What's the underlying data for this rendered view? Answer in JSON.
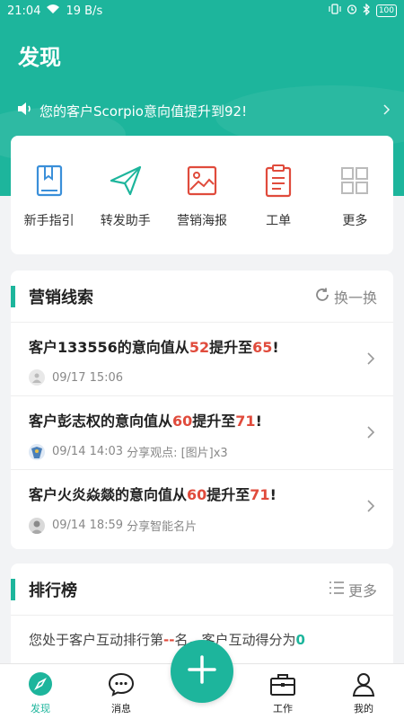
{
  "status_bar": {
    "time": "21:04",
    "net_speed": "19 B/s",
    "battery": "100"
  },
  "header": {
    "title": "发现"
  },
  "notice": {
    "text": "您的客户Scorpio意向值提升到92!"
  },
  "shortcuts": [
    {
      "label": "新手指引",
      "icon": "guide-book-icon",
      "color": "#3a8fd9"
    },
    {
      "label": "转发助手",
      "icon": "paper-plane-icon",
      "color": "#1db59c"
    },
    {
      "label": "营销海报",
      "icon": "poster-image-icon",
      "color": "#e04b3c"
    },
    {
      "label": "工单",
      "icon": "clipboard-icon",
      "color": "#e04b3c"
    },
    {
      "label": "更多",
      "icon": "grid-icon",
      "color": "#bbbbbb"
    }
  ],
  "leads": {
    "title": "营销线索",
    "refresh_label": "换一换",
    "items": [
      {
        "prefix": "客户133556的意向值从",
        "from": "52",
        "mid": "提升至",
        "to": "65",
        "suffix": "!",
        "time": "09/17 15:06",
        "share": ""
      },
      {
        "prefix": "客户彭志权的意向值从",
        "from": "60",
        "mid": "提升至",
        "to": "71",
        "suffix": "!",
        "time": "09/14 14:03",
        "share": "分享观点:  [图片]x3"
      },
      {
        "prefix": "客户火炎焱燚的意向值从",
        "from": "60",
        "mid": "提升至",
        "to": "71",
        "suffix": "!",
        "time": "09/14 18:59",
        "share": "分享智能名片"
      }
    ]
  },
  "ranking": {
    "title": "排行榜",
    "more_label": "更多",
    "line_prefix": "您处于客户互动排行第",
    "rank_value": "--",
    "line_mid": "名，客户互动得分为",
    "score_value": "0"
  },
  "tabbar": [
    {
      "label": "发现",
      "active": true
    },
    {
      "label": "消息",
      "active": false
    },
    {
      "label": "工作",
      "active": false
    },
    {
      "label": "我的",
      "active": false
    }
  ],
  "colors": {
    "primary": "#1db59c",
    "highlight": "#e04b3c"
  }
}
